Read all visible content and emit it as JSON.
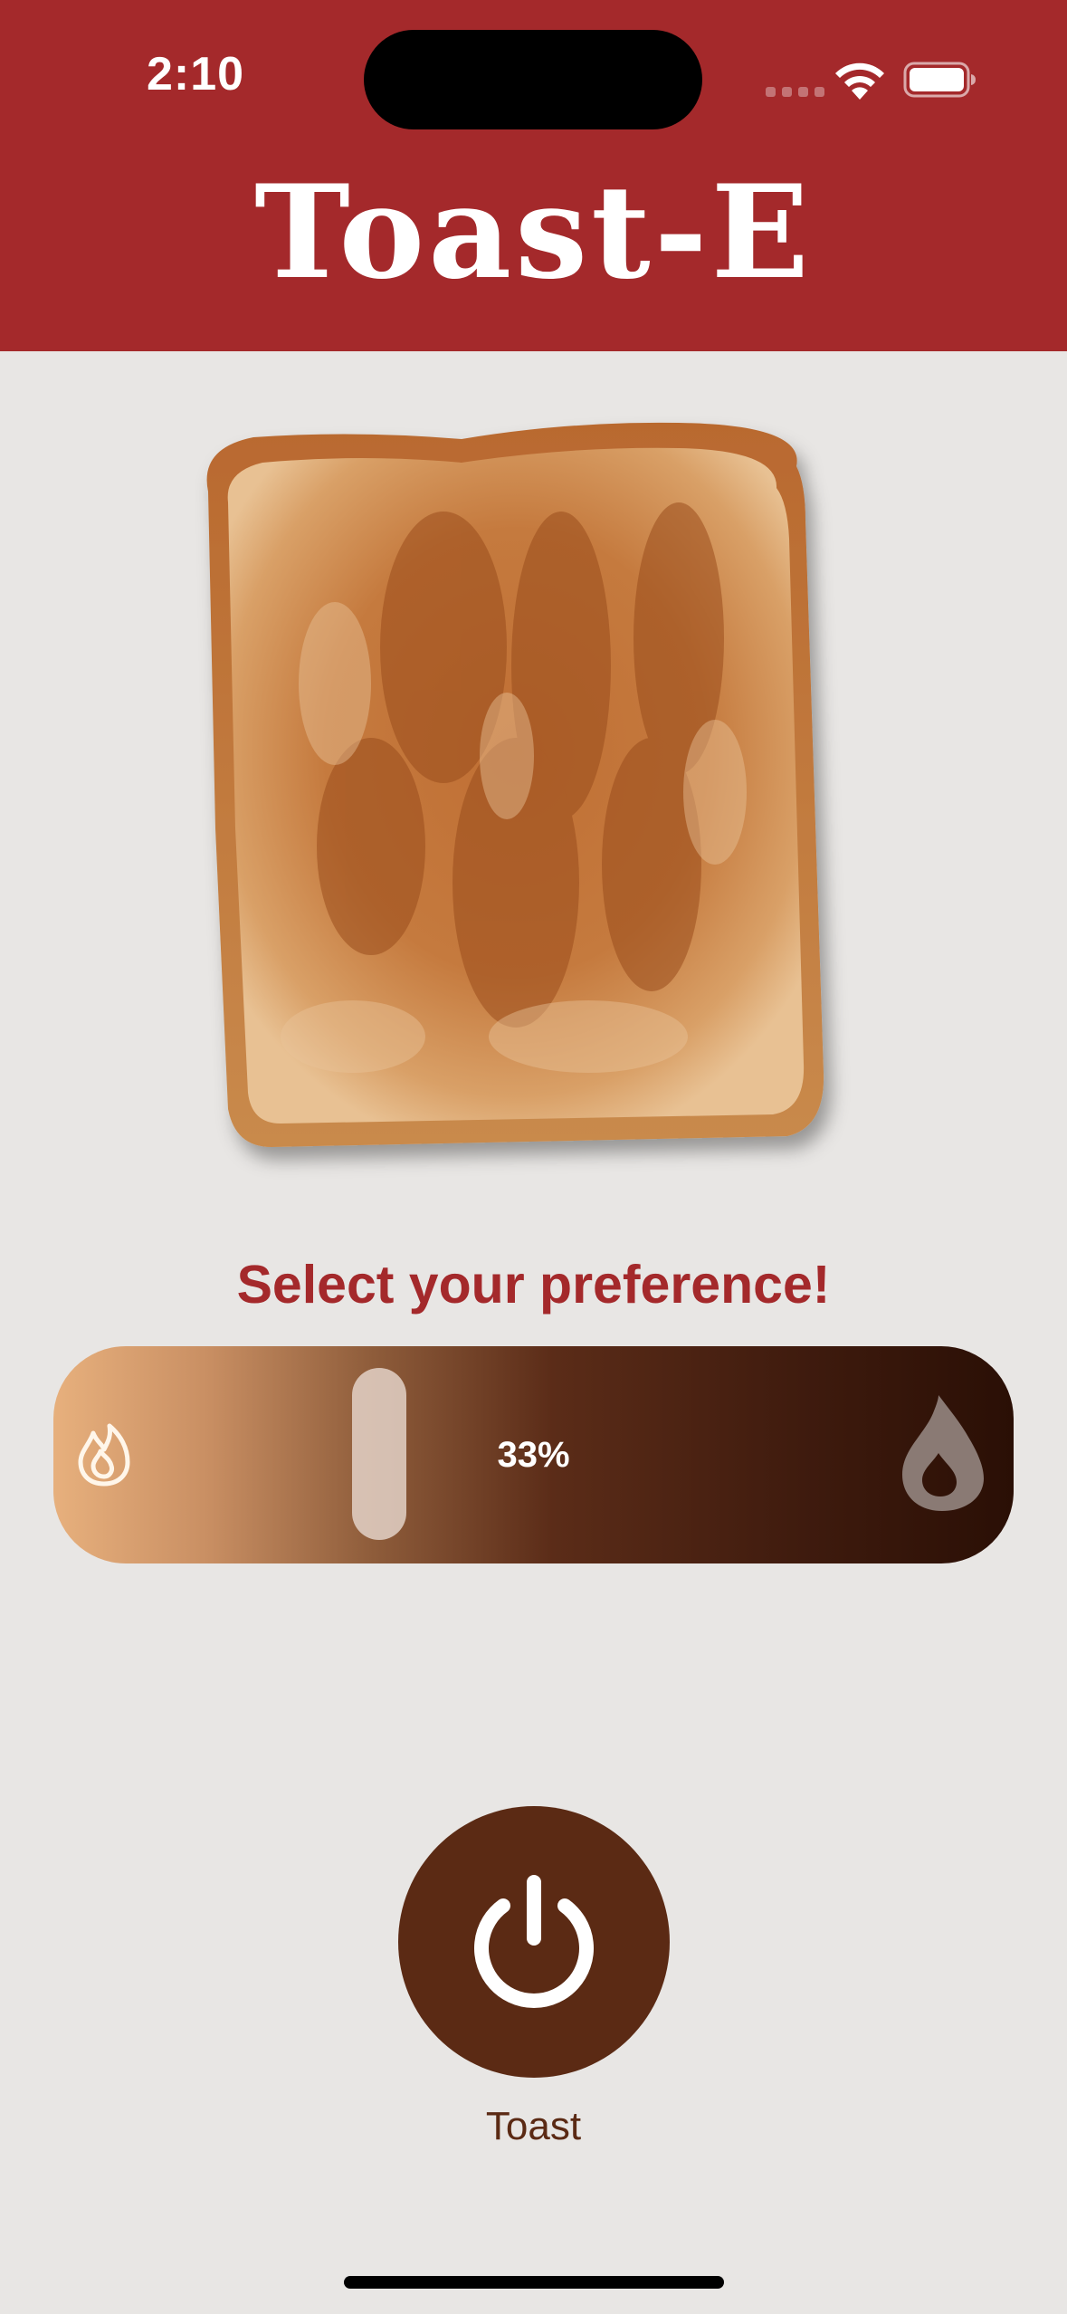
{
  "status_bar": {
    "time": "2:10"
  },
  "header": {
    "title": "Toast-E",
    "background_color": "#a4292b"
  },
  "toast_image": {
    "subject": "toasted-bread-slice"
  },
  "preference": {
    "label": "Select your preference!",
    "slider_value_text": "33%",
    "slider_fraction": 0.33,
    "min_icon": "flame-small-icon",
    "max_icon": "flame-large-icon"
  },
  "power": {
    "icon": "power-icon",
    "label": "Toast",
    "color": "#5b2a14"
  }
}
